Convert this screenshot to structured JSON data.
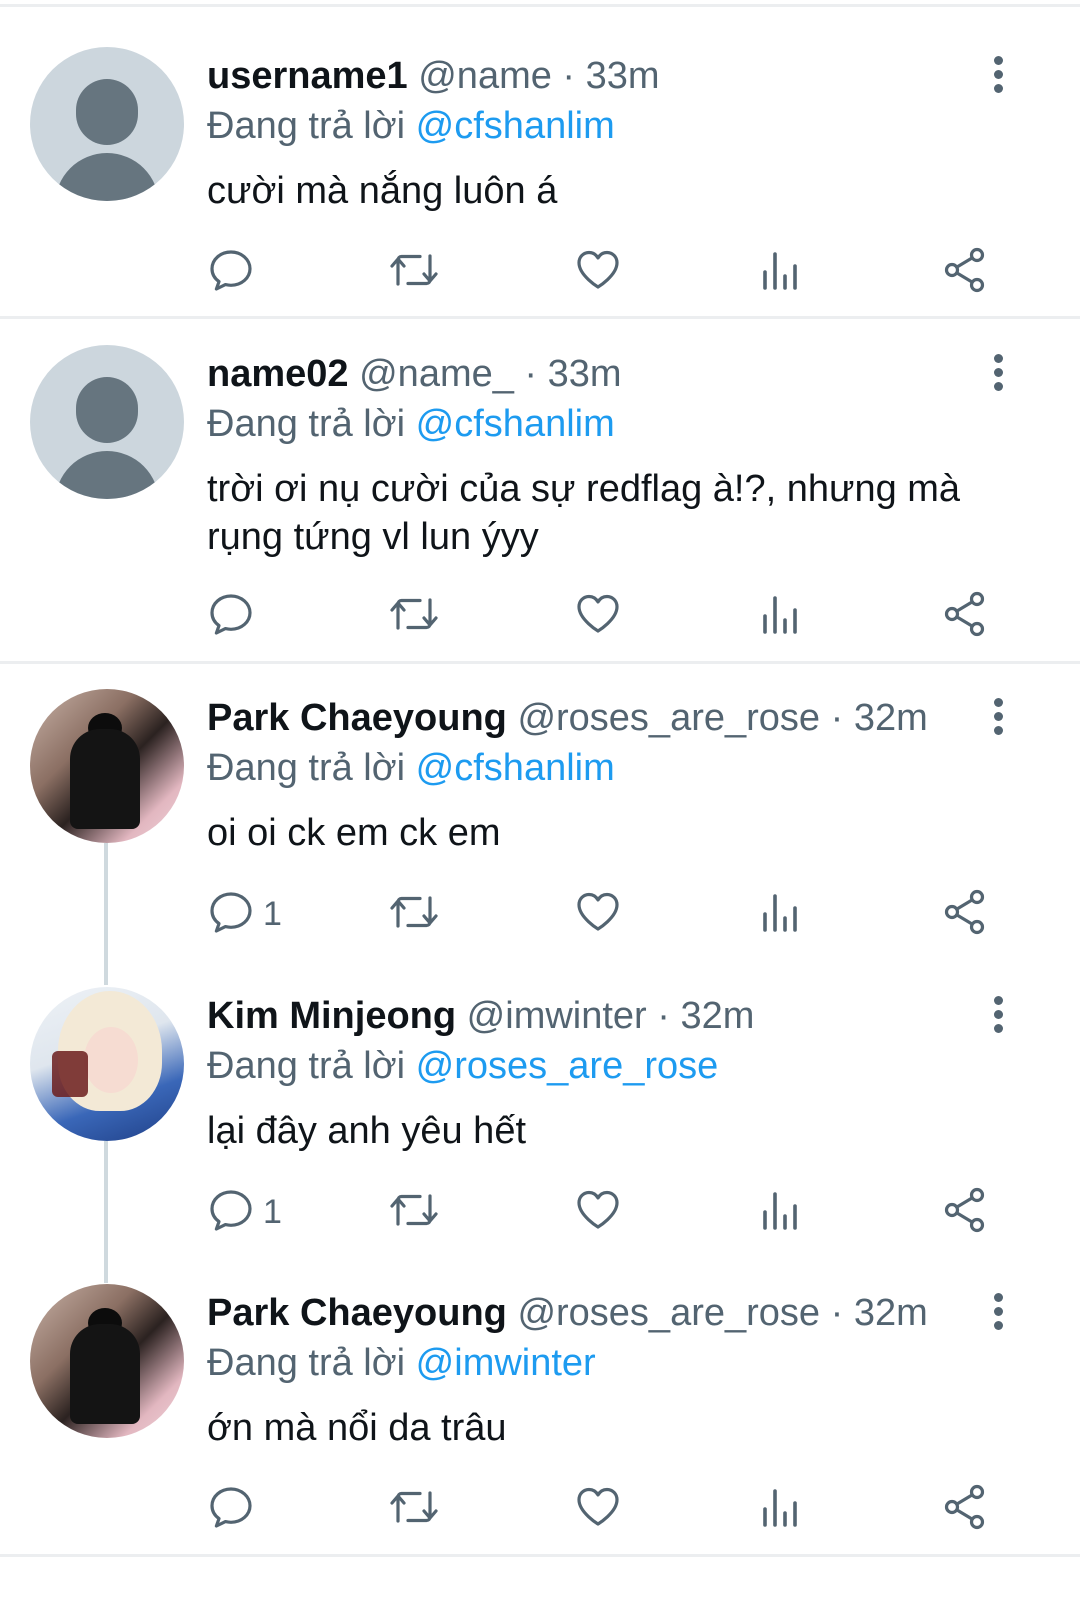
{
  "tweets": [
    {
      "name": "username1",
      "handle": "@name · 33m",
      "reply_prefix": "Đang trả lời",
      "reply_to": "@cfshanlim",
      "text": "cười mà nắng luôn á",
      "reply_count": "",
      "avatar": "default-avatar"
    },
    {
      "name": "name02",
      "handle": "@name_ · 33m",
      "reply_prefix": "Đang trả lời",
      "reply_to": "@cfshanlim",
      "text": "trời ơi nụ cười của sự redflag à!?, nhưng mà rụng tứng vl lun ýyy",
      "reply_count": "",
      "avatar": "default-avatar"
    },
    {
      "name": "Park Chaeyoung",
      "handle": "@roses_are_rose · 32m",
      "reply_prefix": "Đang trả lời",
      "reply_to": "@cfshanlim",
      "text": "oi oi ck em ck em",
      "reply_count": "1",
      "avatar": "photo-avatar"
    },
    {
      "name": "Kim Minjeong",
      "handle": "@imwinter · 32m",
      "reply_prefix": "Đang trả lời",
      "reply_to": "@roses_are_rose",
      "text": "lại đây anh yêu hết",
      "reply_count": "1",
      "avatar": "photo-avatar"
    },
    {
      "name": "Park Chaeyoung",
      "handle": "@roses_are_rose · 32m",
      "reply_prefix": "Đang trả lời",
      "reply_to": "@imwinter",
      "text": "ớn mà nổi da trâu",
      "reply_count": "",
      "avatar": "photo-avatar"
    }
  ],
  "icons": [
    "more-icon",
    "reply-icon",
    "retweet-icon",
    "like-icon",
    "views-icon",
    "share-icon"
  ],
  "colors": {
    "text": "#0f1419",
    "secondary": "#536471",
    "accent": "#1d9bf0",
    "divider": "#eceef0",
    "thread_line": "#cfd9de"
  }
}
